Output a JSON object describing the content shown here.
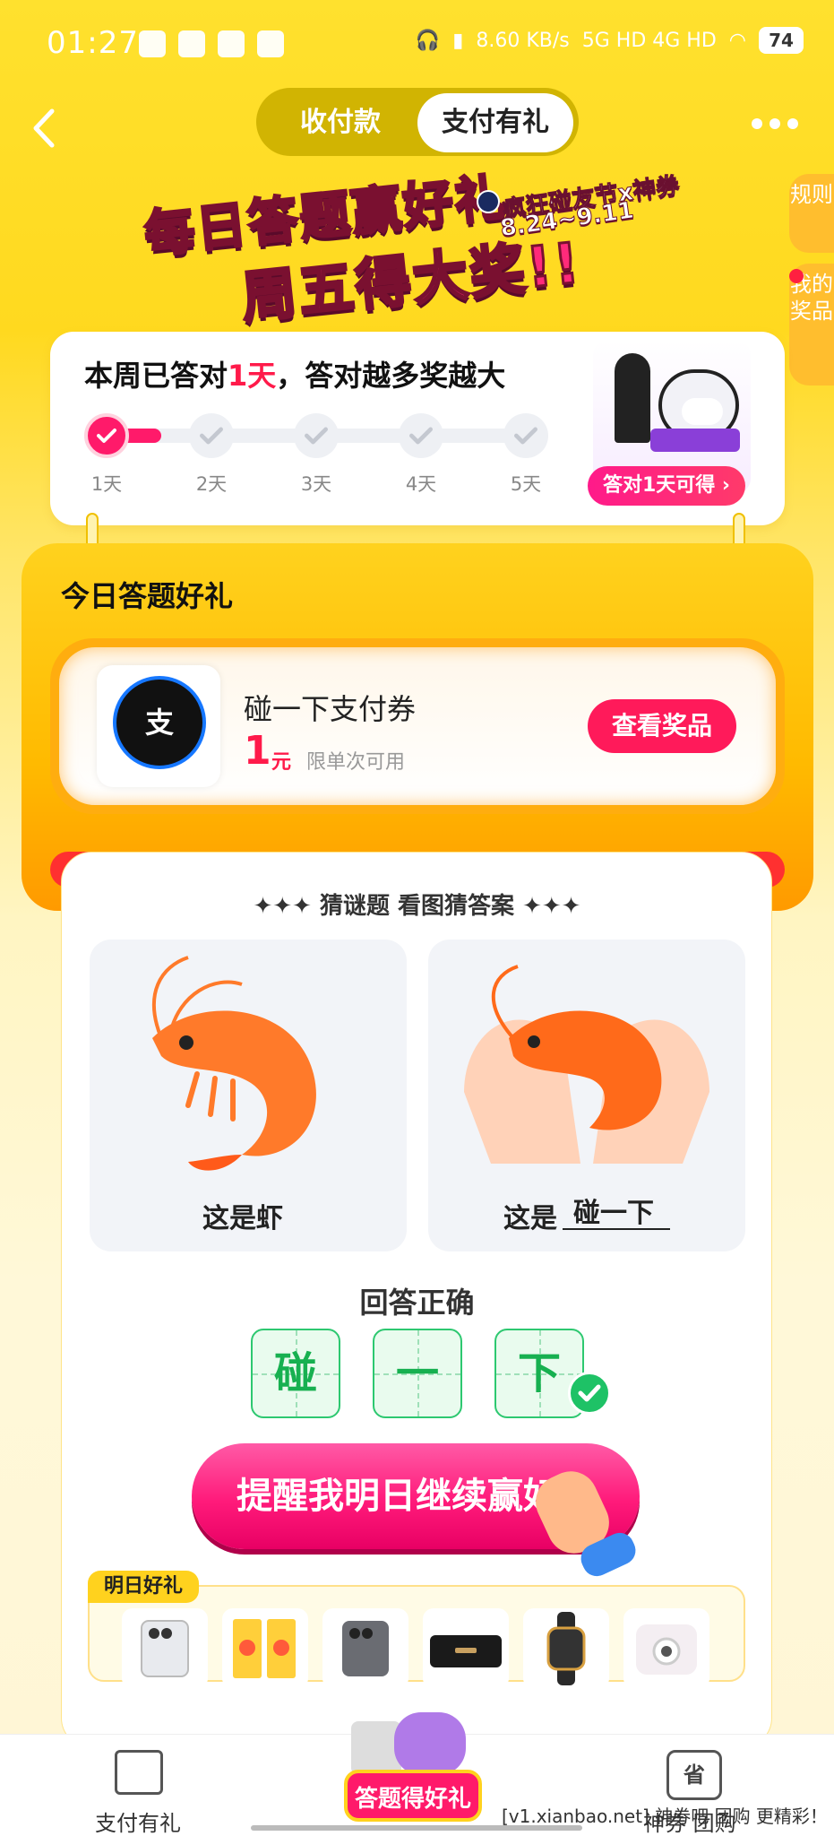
{
  "status_bar": {
    "time": "01:27",
    "net_speed": "8.60",
    "net_unit": "KB/s",
    "signal": "5G HD 4G HD",
    "battery": "74"
  },
  "nav": {
    "tab_pay": "收付款",
    "tab_gift": "支付有礼"
  },
  "side": {
    "rules": "规则",
    "my_prizes": "我的奖品"
  },
  "banner": {
    "line1": "每日答题赢好礼",
    "line2": "周五得大奖!!",
    "event": "疯狂碰友节x神券",
    "dates": "8.24~9.11"
  },
  "weekly": {
    "title_prefix": "本周已答对",
    "title_count": "1天",
    "title_suffix": "，答对越多奖越大",
    "days": [
      "1天",
      "2天",
      "3天",
      "4天",
      "5天"
    ],
    "completed_days": 1,
    "prize_button": "答对1天可得 ›"
  },
  "today": {
    "title": "今日答题好礼",
    "coupon_name": "碰一下支付券",
    "coupon_amount": "1",
    "coupon_unit": "元",
    "coupon_limit": "限单次可用",
    "logo_text": "支",
    "view_button": "查看奖品"
  },
  "quiz": {
    "title": "✦✦✦ 猜谜题 看图猜答案 ✦✦✦",
    "card1_caption": "这是虾",
    "card2_prefix": "这是",
    "card2_answer": "碰一下",
    "result": "回答正确",
    "answer_chars": [
      "碰",
      "一",
      "下"
    ],
    "remind_button": "提醒我明日继续赢好礼"
  },
  "tomorrow": {
    "tag": "明日好礼",
    "items": [
      "phone-white",
      "red-envelope",
      "phone-gray",
      "speaker",
      "smart-watch",
      "instant-camera"
    ]
  },
  "bottom_nav": {
    "left": "支付有礼",
    "center": "答题得好礼",
    "right_icon_text": "省",
    "right": "神券 团购"
  },
  "watermark": "[v1.xianbao.net] 神券吧 团购 更精彩！",
  "colors": {
    "primary_yellow": "#ffd91f",
    "accent_pink": "#ff1a6a",
    "success_green": "#1ec266"
  }
}
